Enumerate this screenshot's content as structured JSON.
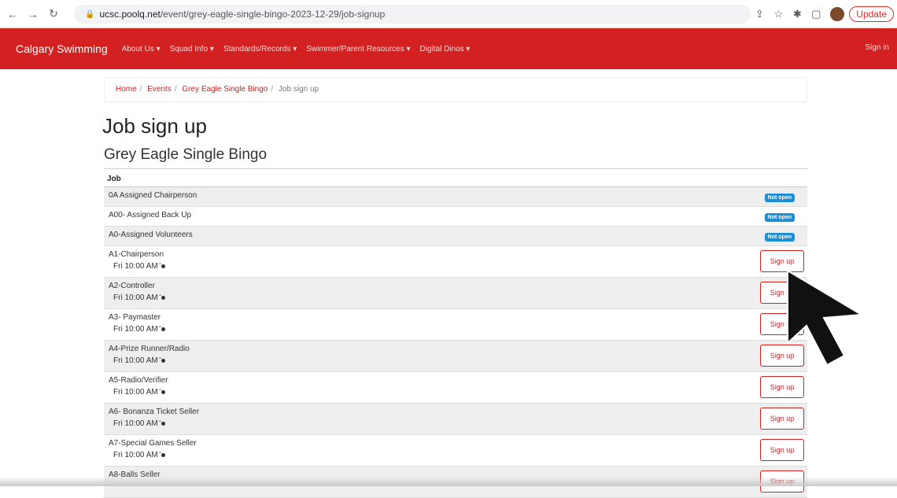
{
  "browser": {
    "url_host": "ucsc.poolq.net",
    "url_path": "/event/grey-eagle-single-bingo-2023-12-29/job-signup",
    "update_label": "Update"
  },
  "nav": {
    "brand": "Calgary Swimming",
    "items": [
      "About Us ▾",
      "Squad Info ▾",
      "Standards/Records ▾",
      "Swimmer/Parent Resources ▾",
      "Digital Dinos ▾"
    ],
    "signin": "Sign in"
  },
  "breadcrumb": {
    "home": "Home",
    "events": "Events",
    "event": "Grey Eagle Single Bingo",
    "current": "Job sign up"
  },
  "page": {
    "title": "Job sign up",
    "subtitle": "Grey Eagle Single Bingo",
    "column_header": "Job"
  },
  "jobs": [
    {
      "name": "0A Assigned Chairperson",
      "status": "Not open"
    },
    {
      "name": "A00- Assigned Back Up",
      "status": "Not open"
    },
    {
      "name": "A0-Assigned Volunteers",
      "status": "Not open"
    },
    {
      "name": "A1-Chairperson",
      "time": "Fri 10:00 AM",
      "action": "Sign up"
    },
    {
      "name": "A2-Controller",
      "time": "Fri 10:00 AM",
      "action": "Sign up"
    },
    {
      "name": "A3- Paymaster",
      "time": "Fri 10:00 AM",
      "action": "Sign up"
    },
    {
      "name": "A4-Prize Runner/Radio",
      "time": "Fri 10:00 AM",
      "action": "Sign up"
    },
    {
      "name": "A5-Radio/Verifier",
      "time": "Fri 10:00 AM",
      "action": "Sign up"
    },
    {
      "name": "A6- Bonanza Ticket Seller",
      "time": "Fri 10:00 AM",
      "action": "Sign up"
    },
    {
      "name": "A7-Special Games Seller",
      "time": "Fri 10:00 AM",
      "action": "Sign up"
    },
    {
      "name": "A8-Balls Seller",
      "action": "Sign up"
    }
  ]
}
